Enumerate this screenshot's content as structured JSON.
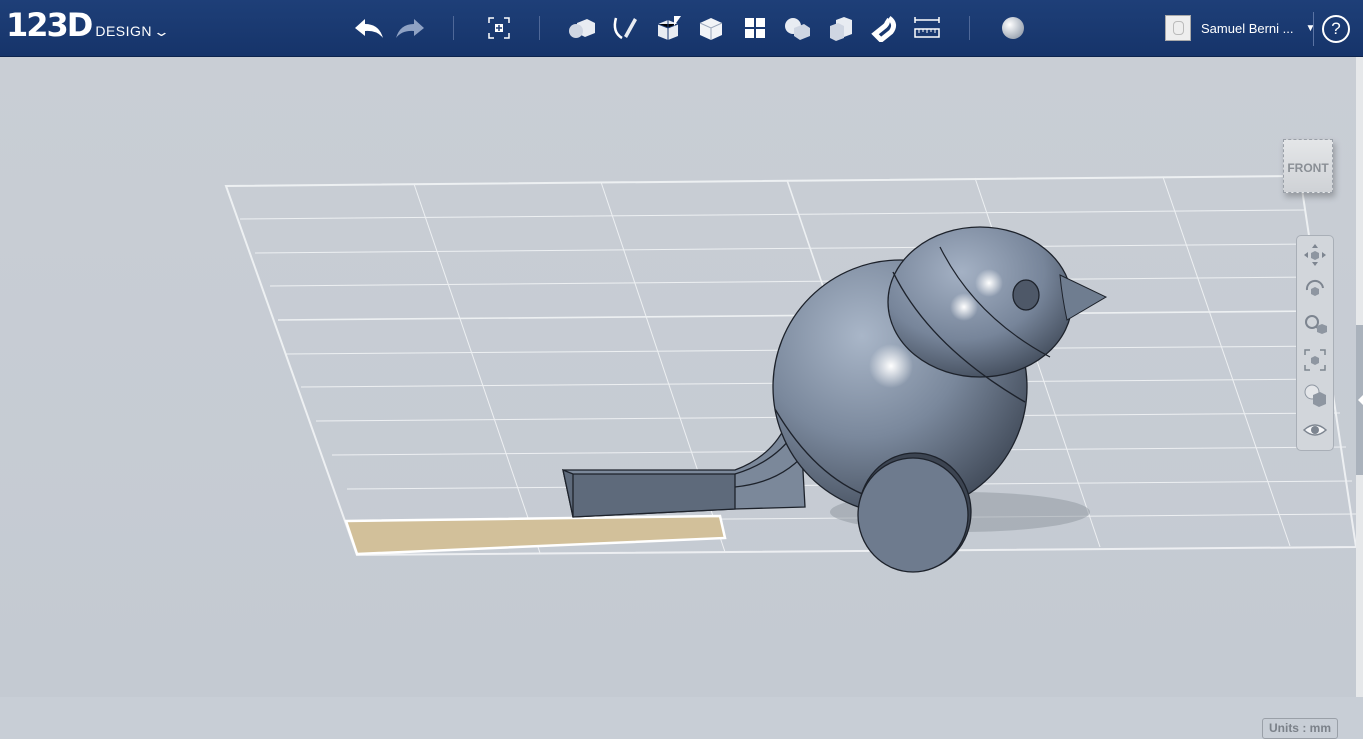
{
  "app": {
    "logo_num": "123D",
    "logo_design": "DESIGN",
    "logo_chevron": "⌄",
    "user_name": "Samuel Berni ...",
    "user_caret": "▼",
    "help": "?"
  },
  "toolbar": {
    "icons": [
      "undo-icon",
      "redo-icon",
      "transform-icon",
      "primitives-icon",
      "sketch-icon",
      "construct-icon",
      "modify-icon",
      "pattern-icon",
      "grouping-icon",
      "combine-icon",
      "snap-icon",
      "measure-icon",
      "material-icon"
    ]
  },
  "viewport": {
    "navcube_label": "FRONT",
    "units_label": "Units : mm",
    "nav_tools": [
      "pan-icon",
      "orbit-icon",
      "zoom-icon",
      "fit-icon",
      "view-mode-icon",
      "visibility-eye-icon"
    ]
  },
  "colors": {
    "topbar": "#1b3a73",
    "viewport_bg": "#c8ced6",
    "model": "#6f7d90",
    "grid_line": "#ffffff",
    "selection": "#d2c09a"
  }
}
